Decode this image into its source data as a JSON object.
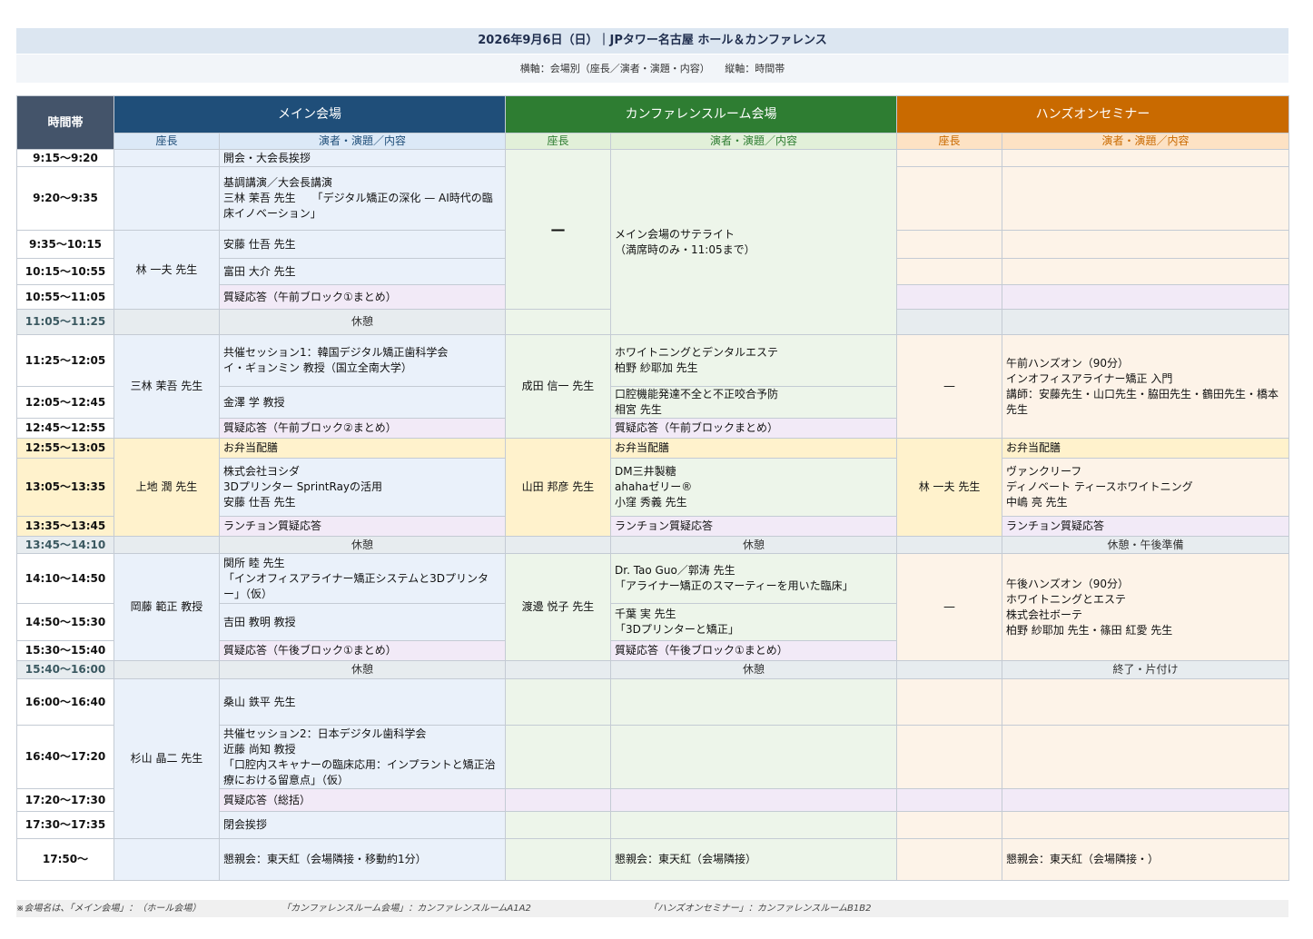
{
  "header": {
    "title": "2026年9月6日（日）｜JPタワー名古屋 ホール＆カンファレンス",
    "subtitle": "横軸：会場別（座長／演者・演題・内容）　　縦軸：時間帯"
  },
  "columns": {
    "time": "時間帯",
    "main": "メイン会場",
    "conf": "カンファレンスルーム会場",
    "hands": "ハンズオンセミナー",
    "chair": "座長",
    "content": "演者・演題／内容"
  },
  "times": {
    "t1": "9:15〜9:20",
    "t2": "9:20〜9:35",
    "t3": "9:35〜10:15",
    "t4": "10:15〜10:55",
    "t5": "10:55〜11:05",
    "t6": "11:05〜11:25",
    "t7": "11:25〜12:05",
    "t8": "12:05〜12:45",
    "t9": "12:45〜12:55",
    "t10": "12:55〜13:05",
    "t11": "13:05〜13:35",
    "t12": "13:35〜13:45",
    "t13": "13:45〜14:10",
    "t14": "14:10〜14:50",
    "t15": "14:50〜15:30",
    "t16": "15:30〜15:40",
    "t17": "15:40〜16:00",
    "t18": "16:00〜16:40",
    "t19": "16:40〜17:20",
    "t20": "17:20〜17:30",
    "t21": "17:30〜17:35",
    "t22": "17:50〜"
  },
  "main": {
    "chair1": "林 一夫 先生",
    "chair2": "三林 茉吾 先生",
    "chair3": "上地 潤 先生",
    "chair4": "岡藤 範正 教授",
    "chair5": "杉山 晶二 先生",
    "r1": "開会・大会長挨拶",
    "r2": "基調講演／大会長講演\n三林 茉吾 先生　　「デジタル矯正の深化 — AI時代の臨床イノベーション」",
    "r3": "安藤 仕吾 先生",
    "r4": "富田 大介 先生",
    "r5": "質疑応答（午前ブロック①まとめ）",
    "r7": "共催セッション1：韓国デジタル矯正歯科学会\nイ・ギョンミン 教授（国立全南大学）",
    "r8": "金澤 学 教授",
    "r9": "質疑応答（午前ブロック②まとめ）",
    "r10": "お弁当配膳",
    "r11": "株式会社ヨシダ\n3Dプリンター SprintRayの活用\n安藤 仕吾 先生",
    "r12": "ランチョン質疑応答",
    "r14": "関所 睦 先生\n「インオフィスアライナー矯正システムと3Dプリンター」（仮）",
    "r15": "吉田 教明 教授",
    "r16": "質疑応答（午後ブロック①まとめ）",
    "r18": "桑山 鉄平 先生",
    "r19": "共催セッション2：日本デジタル歯科学会\n近藤 尚知 教授\n「口腔内スキャナーの臨床応用：インプラントと矯正治療における留意点」（仮）",
    "r20": "質疑応答（総括）",
    "r21": "閉会挨拶",
    "r22": "懇親会：東天紅（会場隣接・移動約1分）"
  },
  "conf": {
    "dash": "—",
    "satellite": "メイン会場のサテライト\n（満席時のみ・11:05まで）",
    "chair2": "成田 信一 先生",
    "chair3": "山田 邦彦 先生",
    "chair4": "渡邊 悦子 先生",
    "r7": "ホワイトニングとデンタルエステ\n柏野 紗耶加 先生",
    "r8": "口腔機能発達不全と不正咬合予防\n相宮 先生",
    "r9": "質疑応答（午前ブロックまとめ）",
    "r10": "お弁当配膳",
    "r11": "DM三井製糖\nahahaゼリー®\n小窪 秀義 先生",
    "r12": "ランチョン質疑応答",
    "r14": "Dr. Tao Guo／郭涛 先生\n「アライナー矯正のスマーティーを用いた臨床」",
    "r15": "千葉 実 先生\n「3Dプリンターと矯正」",
    "r16": "質疑応答（午後ブロック①まとめ）",
    "r22": "懇親会：東天紅（会場隣接）"
  },
  "hands": {
    "dash1": "—",
    "dash2": "—",
    "chair3": "林 一夫 先生",
    "am": "午前ハンズオン（90分）\nインオフィスアライナー矯正 入門\n講師：安藤先生・山口先生・脇田先生・鶴田先生・橋本先生",
    "r10": "お弁当配膳",
    "r11": "ヴァンクリーフ\nディノベート ティースホワイトニング\n中嶋 亮 先生",
    "r12": "ランチョン質疑応答",
    "pm": "午後ハンズオン（90分）\nホワイトニングとエステ\n株式会社ボーテ\n柏野 紗耶加 先生・篠田 紅愛 先生",
    "r22": "懇親会：東天紅（会場隣接・）"
  },
  "breaks": {
    "break": "休憩",
    "hands13": "休憩・午後準備",
    "hands17": "終了・片付け"
  },
  "footer": {
    "n1": "※会場名は、「メイン会場」：（ホール会場）",
    "n2": "「カンファレンスルーム会場」：カンファレンスルームA1A2",
    "n3": "「ハンズオンセミナー」：カンファレンスルームB1B2"
  }
}
